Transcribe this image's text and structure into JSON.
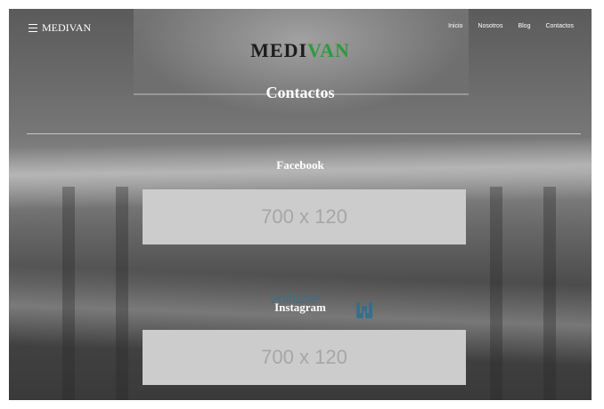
{
  "nav": {
    "brand": "MEDIVAN",
    "links": [
      "Inicio",
      "Nosotros",
      "Blog",
      "Contactos"
    ]
  },
  "logo": {
    "part1": "MEDI",
    "part2": "VAN"
  },
  "page": {
    "title": "Contactos"
  },
  "sections": [
    {
      "title": "Facebook",
      "placeholder": "700 x 120"
    },
    {
      "title": "Instagram",
      "placeholder": "700 x 120"
    }
  ],
  "background_sign": "Volluzie",
  "colors": {
    "logo_dark": "#1d1d1d",
    "logo_accent": "#2f9a3e",
    "placeholder_bg": "#cccccc",
    "placeholder_text": "#a6a6a6"
  }
}
